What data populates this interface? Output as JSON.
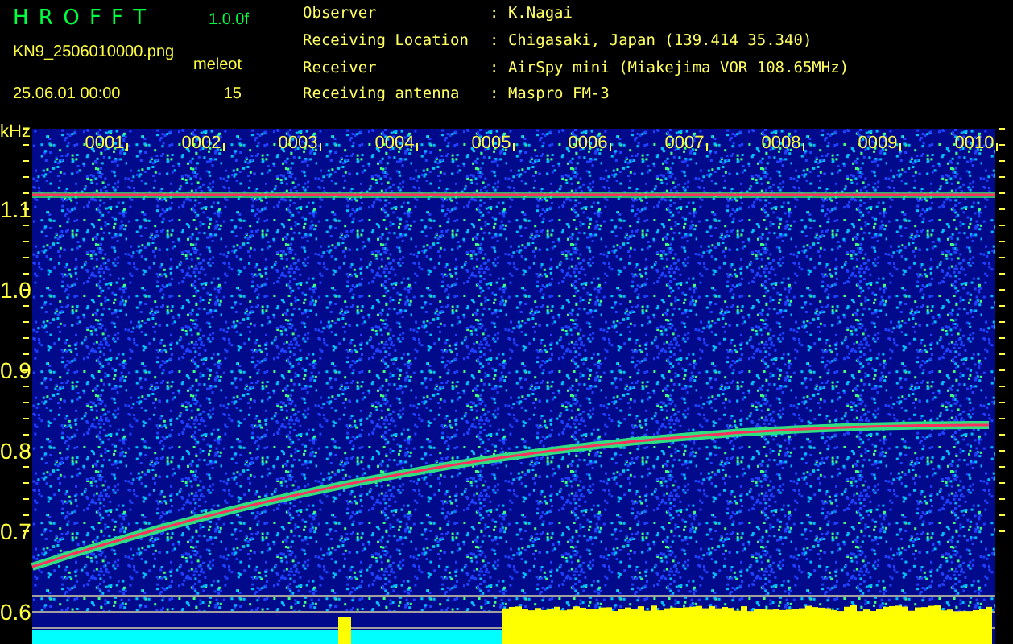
{
  "app": {
    "title": "H R O F F T",
    "version": "1.0.0f",
    "file": "KN9_2506010000.png",
    "datetime": "25.06.01 00:00",
    "mode": "meleot",
    "count": "15"
  },
  "station": [
    {
      "label": "Observer",
      "value": ": K.Nagai"
    },
    {
      "label": "Receiving Location",
      "value": ": Chigasaki, Japan (139.414 35.340)"
    },
    {
      "label": "Receiver",
      "value": ": AirSpy mini (Miakejima VOR 108.65MHz)"
    },
    {
      "label": "Receiving antenna",
      "value": ": Maspro FM-3"
    }
  ],
  "spectrogram": {
    "unit": "kHz",
    "y_labels": [
      "1.1",
      "1.0",
      "0.9",
      "0.8",
      "0.7",
      "0.6"
    ],
    "time_labels": [
      "0001",
      "0002",
      "0003",
      "0004",
      "0005",
      "0006",
      "0007",
      "0008",
      "0009",
      "0010"
    ]
  }
}
